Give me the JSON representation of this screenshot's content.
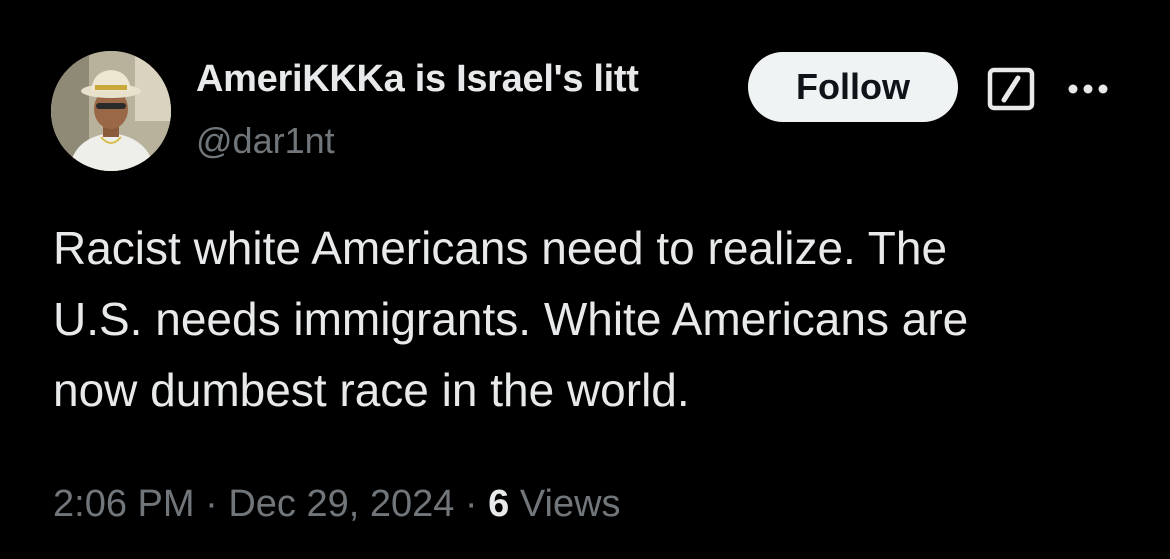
{
  "author": {
    "display_name": "AmeriKKKa is Israel's litt",
    "handle": "@dar1nt",
    "avatar_icon": "user-photo-avatar"
  },
  "actions": {
    "follow_label": "Follow",
    "grok_icon": "grok-slash-icon",
    "more_icon": "more-dots-icon"
  },
  "tweet": {
    "lines": [
      "Racist white Americans need to realize. The",
      "U.S. needs immigrants. White Americans are",
      "now dumbest race in the world."
    ]
  },
  "meta": {
    "time": "2:06 PM",
    "separator": " · ",
    "date": "Dec 29, 2024",
    "views_count": "6",
    "views_label": " Views"
  },
  "colors": {
    "background": "#000000",
    "text_primary": "#e7e9ea",
    "text_secondary": "#71767b",
    "follow_bg": "#eff3f4",
    "follow_text": "#0f1419"
  }
}
